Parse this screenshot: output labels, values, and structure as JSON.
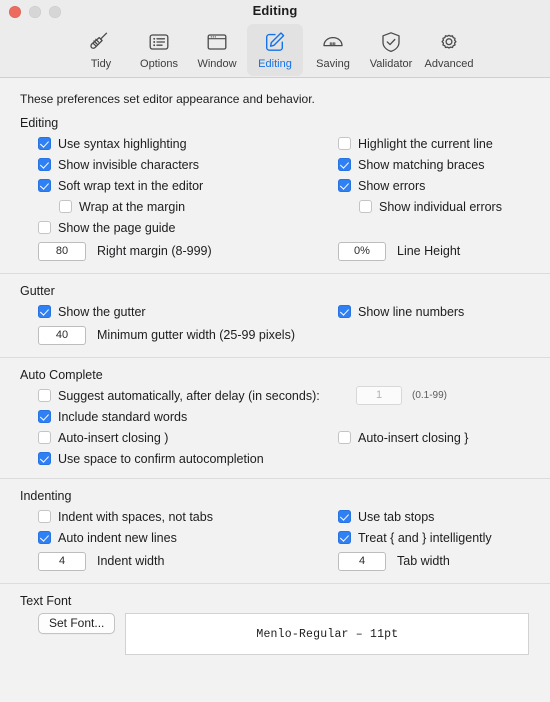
{
  "window": {
    "title": "Editing",
    "traffic_lights": [
      "close-button",
      "minimize-button",
      "maximize-button"
    ]
  },
  "toolbar": {
    "items": [
      {
        "label": "Tidy",
        "icon": "broom-icon",
        "selected": false
      },
      {
        "label": "Options",
        "icon": "list-icon",
        "selected": false
      },
      {
        "label": "Window",
        "icon": "window-icon",
        "selected": false
      },
      {
        "label": "Editing",
        "icon": "pencil-square-icon",
        "selected": true
      },
      {
        "label": "Saving",
        "icon": "drive-icon",
        "selected": false
      },
      {
        "label": "Validator",
        "icon": "shield-check-icon",
        "selected": false
      },
      {
        "label": "Advanced",
        "icon": "gear-icon",
        "selected": false
      }
    ]
  },
  "intro": "These preferences set editor appearance and behavior.",
  "sections": {
    "editing": {
      "title": "Editing",
      "left": [
        {
          "label": "Use syntax highlighting",
          "checked": true,
          "indent": 0
        },
        {
          "label": "Show invisible characters",
          "checked": true,
          "indent": 0
        },
        {
          "label": "Soft wrap text in the editor",
          "checked": true,
          "indent": 0
        },
        {
          "label": "Wrap at the margin",
          "checked": false,
          "indent": 1
        },
        {
          "label": "Show the page guide",
          "checked": false,
          "indent": 0
        }
      ],
      "right": [
        {
          "label": "Highlight the current line",
          "checked": false,
          "indent": 0
        },
        {
          "label": "Show matching braces",
          "checked": true,
          "indent": 0
        },
        {
          "label": "Show errors",
          "checked": true,
          "indent": 0
        },
        {
          "label": "Show individual errors",
          "checked": false,
          "indent": 1
        }
      ],
      "field_left": {
        "value": "80",
        "label": "Right margin (8-999)",
        "disabled": false
      },
      "field_right": {
        "value": "0%",
        "label": "Line Height",
        "disabled": false
      }
    },
    "gutter": {
      "title": "Gutter",
      "left": [
        {
          "label": "Show the gutter",
          "checked": true,
          "indent": 0
        }
      ],
      "right": [
        {
          "label": "Show line numbers",
          "checked": true,
          "indent": 0
        }
      ],
      "field_left": {
        "value": "40",
        "label": "Minimum gutter width (25-99 pixels)",
        "disabled": false
      }
    },
    "autocomplete": {
      "title": "Auto Complete",
      "delay_row": {
        "label": "Suggest automatically, after delay (in seconds):",
        "checked": false,
        "value": "1",
        "disabled": true,
        "hint": "(0.1-99)"
      },
      "left": [
        {
          "label": "Include standard words",
          "checked": true,
          "indent": 0
        },
        {
          "label": "Auto-insert closing )",
          "checked": false,
          "indent": 0
        },
        {
          "label": "Use space to confirm autocompletion",
          "checked": true,
          "indent": 0
        }
      ],
      "right": [
        {
          "label": "Auto-insert closing }",
          "checked": false,
          "indent": 0
        }
      ]
    },
    "indenting": {
      "title": "Indenting",
      "left": [
        {
          "label": "Indent with spaces, not tabs",
          "checked": false,
          "indent": 0
        },
        {
          "label": "Auto indent new lines",
          "checked": true,
          "indent": 0
        }
      ],
      "right": [
        {
          "label": "Use tab stops",
          "checked": true,
          "indent": 0
        },
        {
          "label": "Treat { and } intelligently",
          "checked": true,
          "indent": 0
        }
      ],
      "field_left": {
        "value": "4",
        "label": "Indent width",
        "disabled": false
      },
      "field_right": {
        "value": "4",
        "label": "Tab width",
        "disabled": false
      }
    },
    "textfont": {
      "title": "Text Font",
      "button_label": "Set Font...",
      "font_value": "Menlo-Regular – 11pt"
    }
  },
  "colors": {
    "accent": "#2f80f5",
    "selected_tab_text": "#1473e6",
    "window_bg": "#f2f2f2",
    "toolbar_bg": "#ececec",
    "close_light": "#ec6a5e",
    "inactive_light": "#d6d6d6"
  }
}
